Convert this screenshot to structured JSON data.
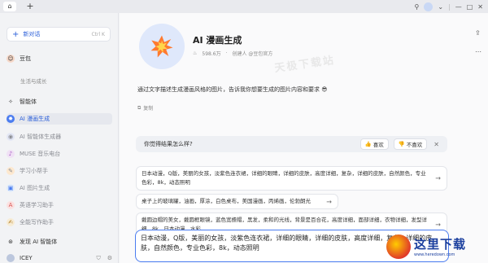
{
  "topbar": {
    "home_icon": "home-icon",
    "plus_label": "+",
    "pin_icon": "pin-icon",
    "minimize": "—",
    "maximize": "□",
    "close": "✕"
  },
  "sidebar": {
    "new_chat": "新对话",
    "new_chat_shortcut": "Ctrl K",
    "user_name": "豆包",
    "user_sub": "生活与成长",
    "section_agents": "智能体",
    "items": [
      {
        "label": "AI 漫画生成",
        "icon": "comic-icon",
        "color": "#4a7cf0"
      },
      {
        "label": "AI 智能体生成器",
        "icon": "robot-icon",
        "color": "#e3e7f5"
      },
      {
        "label": "MUSE 音乐电台",
        "icon": "music-icon",
        "color": "#f0e1f5"
      },
      {
        "label": "学习小帮手",
        "icon": "study-icon",
        "color": "#fde8cf"
      },
      {
        "label": "AI 图片生成",
        "icon": "image-icon",
        "color": "#e1ecfb"
      },
      {
        "label": "英语学习助手",
        "icon": "english-icon",
        "color": "#fbe1e1"
      },
      {
        "label": "全能写作助手",
        "icon": "pen-icon",
        "color": "#f7ecd5"
      }
    ],
    "discover": "发现 AI 智能体",
    "bottom_user": "ICEY"
  },
  "main": {
    "bot_name": "AI 漫画生成",
    "bot_stats": "598.6万",
    "bot_creator": "创建人 @豆包官方",
    "watermark": "天极下载站",
    "description": "通过文字描述生成漫画风格的图片，告诉我你想要生成的图片内容和要求 😎",
    "copy_label": "复制",
    "feedback_question": "你觉得结果怎么样?",
    "like_label": "喜欢",
    "dislike_label": "不喜欢",
    "suggestions": [
      "日本动漫，Q版，美丽的女孩，淡紫色连衣裙，详细的眼睛，详细的皮肤，高度详细，复杂，详细的皮肤，自然颜色，专业色彩，8k，动态照明",
      "桌子上的玻璃罐，油画，厚涂，白色桌布，美国漫画，丙烯画，伦勃朗光",
      "戴圆边帽的美女，戴圆框眼镜，蓝色宽檐帽，黑发，柔和的光线，背景是百合花，高度详细，面部详细，衣物详细，发型详细，8k，日本动漫，水彩"
    ],
    "input_text": "日本动漫，Q版，美丽的女孩，淡紫色连衣裙，详细的眼睛，详细的皮肤，高度详细，复杂，详细的皮肤，自然颜色，专业色彩，8k，动态照明"
  },
  "logo_watermark": {
    "main": "这里下载",
    "sub": "www.heredown.com"
  }
}
